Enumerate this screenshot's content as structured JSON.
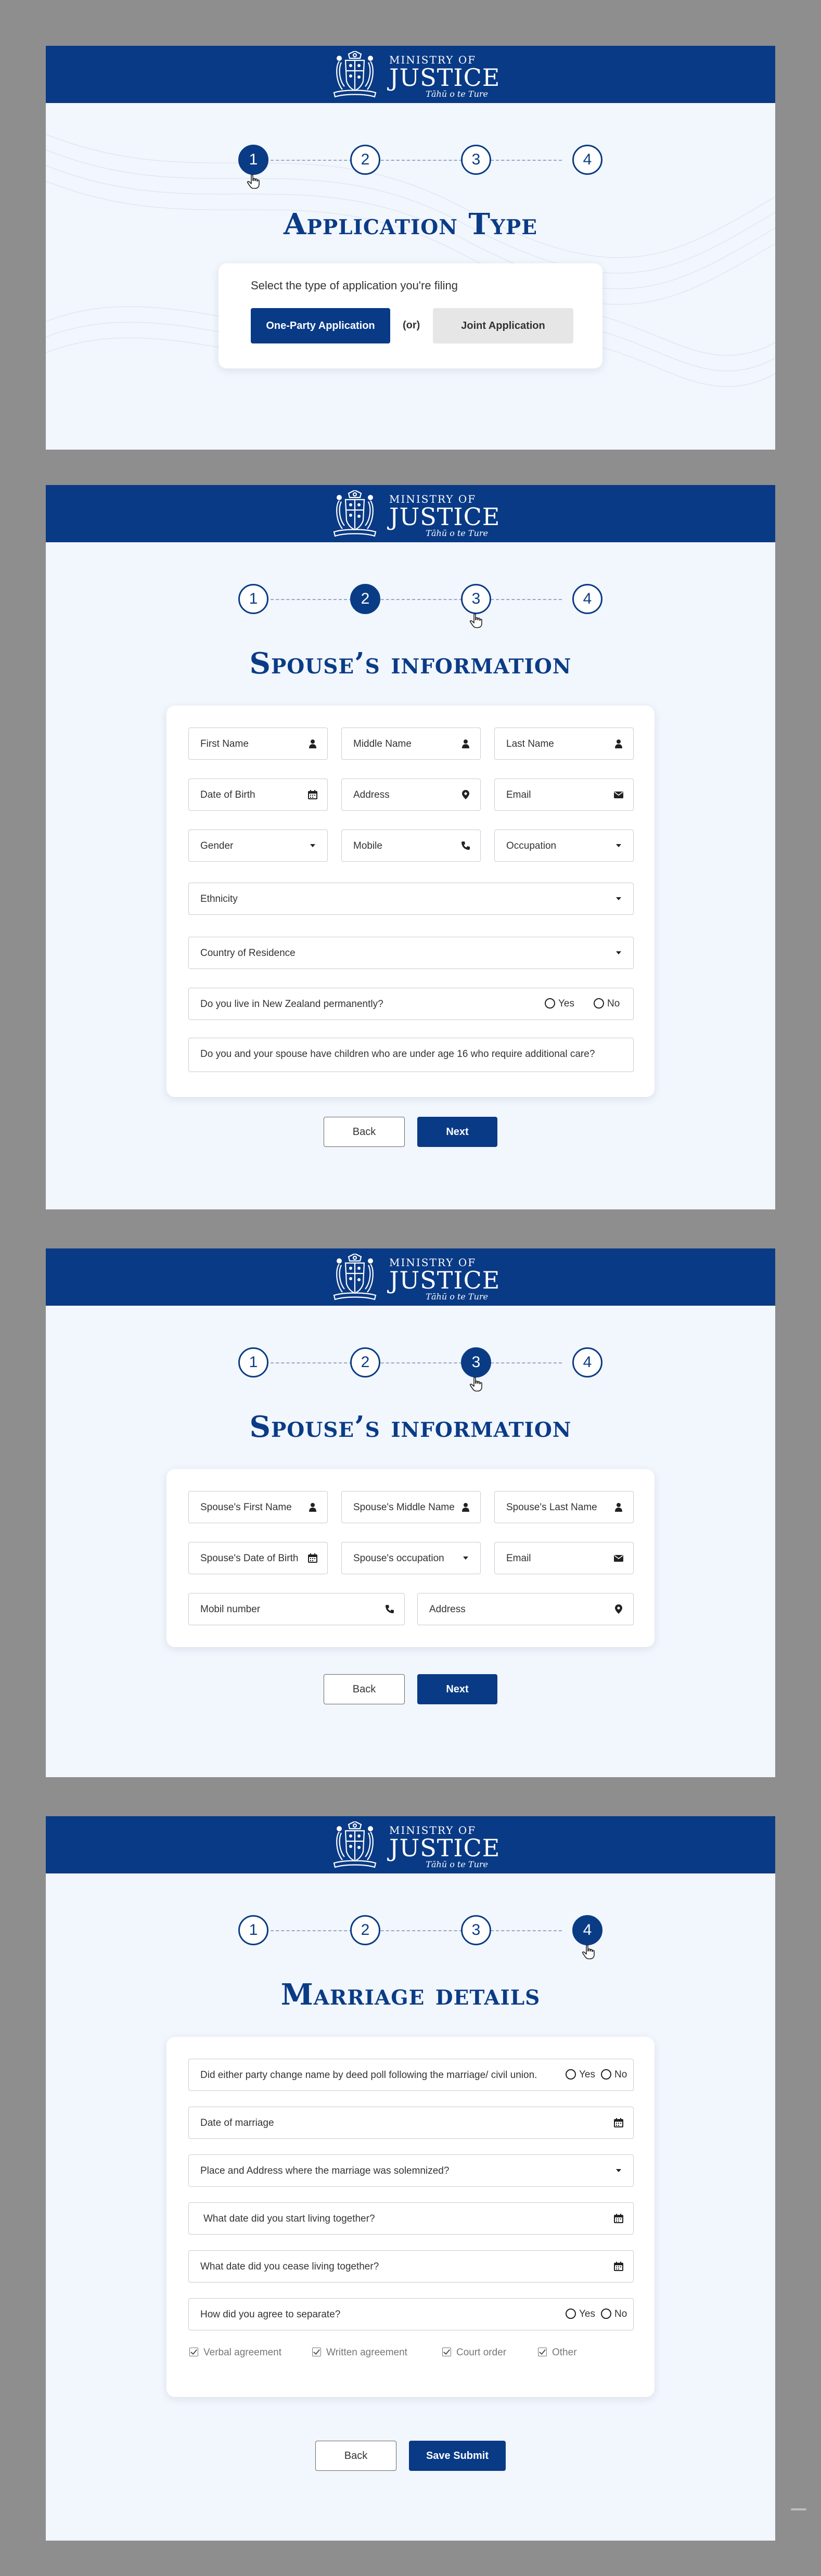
{
  "colors": {
    "primary": "#093a86",
    "panel_bg": "#f2f6fd",
    "page_bg": "#8e8e8e"
  },
  "header": {
    "line1": "MINISTRY OF",
    "line2": "JUSTICE",
    "motto": "Tāhū o te Ture"
  },
  "stepper": {
    "steps": [
      "1",
      "2",
      "3",
      "4"
    ]
  },
  "screen1": {
    "title": "Application Type",
    "prompt": "Select the type of application you're filing",
    "one_party": "One-Party Application",
    "or": "(or)",
    "joint": "Joint Application"
  },
  "screen2": {
    "title": "Spouse’s information",
    "first_name": "First Name",
    "middle_name": "Middle Name",
    "last_name": "Last Name",
    "dob": "Date of Birth",
    "address": "Address",
    "email": "Email",
    "gender": "Gender",
    "mobile": "Mobile",
    "occupation": "Occupation",
    "ethnicity": "Ethnicity",
    "country": "Country of Residence",
    "live_nz": "Do you live in New Zealand permanently?",
    "yes": "Yes",
    "no": "No",
    "children": "Do you and your spouse have children who are under age 16 who require additional care?",
    "back": "Back",
    "next": "Next"
  },
  "screen3": {
    "title": "Spouse’s information",
    "first_name": "Spouse's First Name",
    "middle_name": "Spouse's Middle Name",
    "last_name": "Spouse's Last Name",
    "dob": "Spouse's Date of Birth",
    "occupation": "Spouse's occupation",
    "email": "Email",
    "mobile": "Mobil number",
    "address": "Address",
    "back": "Back",
    "next": "Next"
  },
  "screen4": {
    "title": "Marriage details",
    "name_change": "Did either party change name by deed poll following the marriage/ civil union.",
    "yes": "Yes",
    "no": "No",
    "date_marriage": "Date of marriage",
    "place": "Place and Address where the marriage was solemnized?",
    "start_living": "What date did you start living together?",
    "cease_living": "What date did you cease living together?",
    "separate": "How did you agree to separate?",
    "options": [
      "Verbal agreement",
      "Written agreement",
      "Court order",
      "Other"
    ],
    "back": "Back",
    "submit": "Save Submit"
  },
  "icons": [
    "person-icon",
    "calendar-icon",
    "location-icon",
    "envelope-icon",
    "phone-icon",
    "dropdown-arrow-icon",
    "cursor-hand-icon"
  ]
}
